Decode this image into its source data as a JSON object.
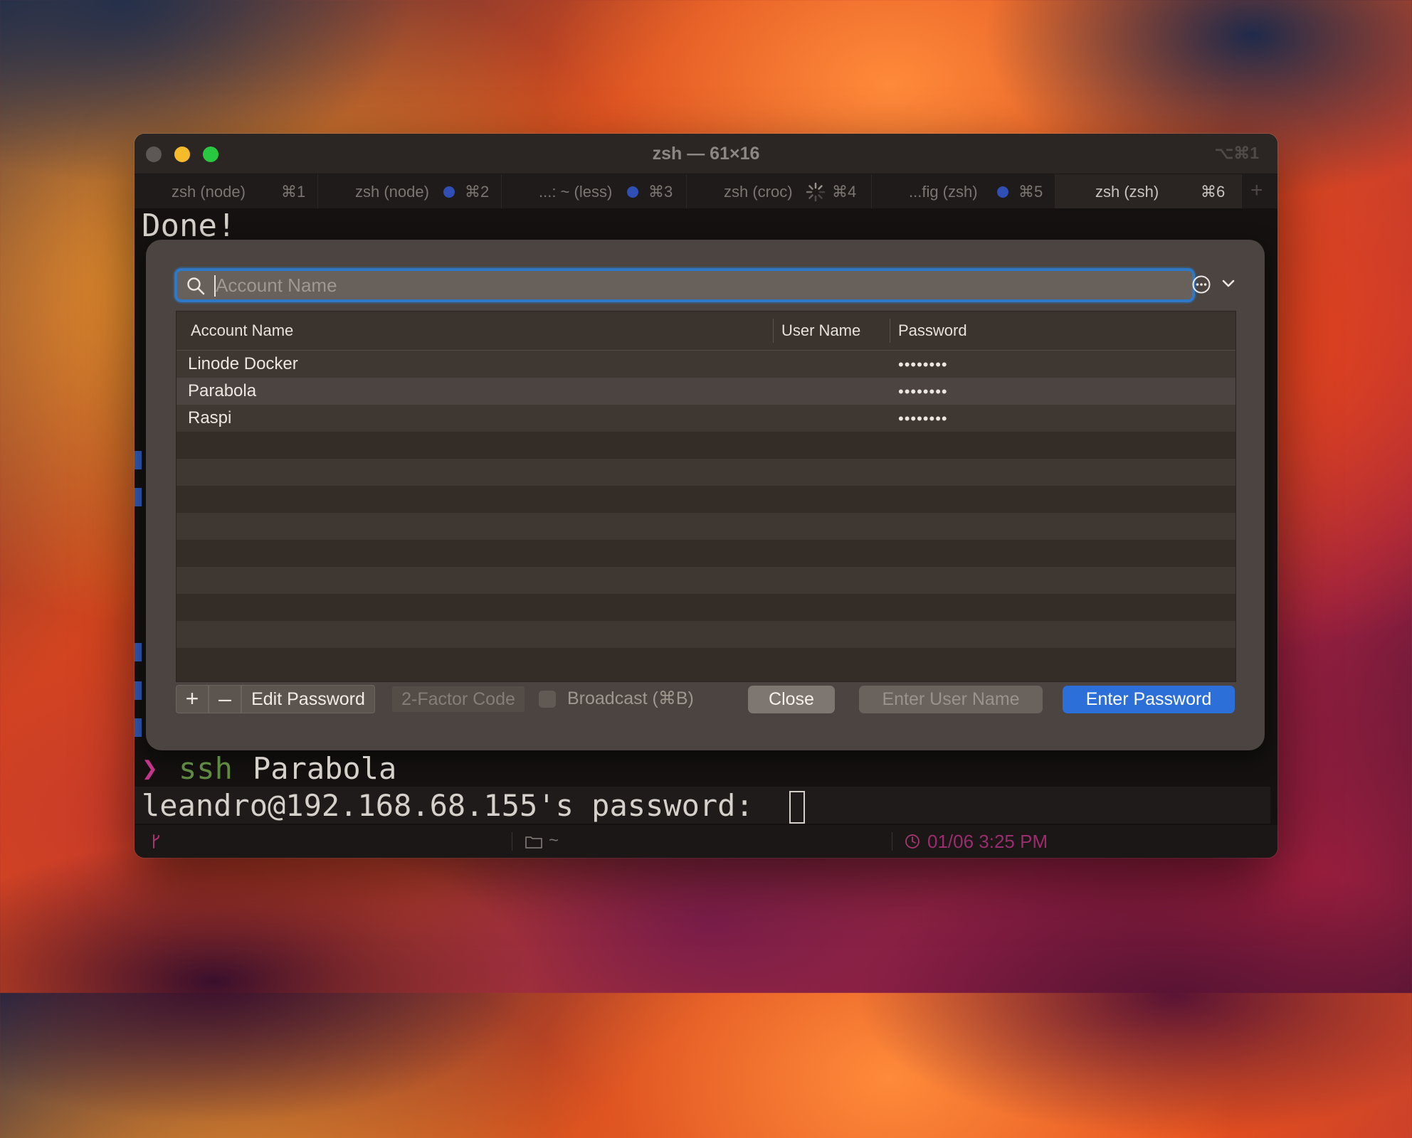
{
  "window": {
    "title": "zsh — 61×16",
    "shortcut": "⌥⌘1",
    "tabs": [
      {
        "label": "zsh (node)",
        "key": "⌘1",
        "dot": false,
        "spinner": false,
        "active": false
      },
      {
        "label": "zsh (node)",
        "key": "⌘2",
        "dot": true,
        "spinner": false,
        "active": false
      },
      {
        "label": "...: ~ (less)",
        "key": "⌘3",
        "dot": true,
        "spinner": false,
        "active": false
      },
      {
        "label": "zsh (croc)",
        "key": "⌘4",
        "dot": false,
        "spinner": true,
        "active": false
      },
      {
        "label": "...fig (zsh)",
        "key": "⌘5",
        "dot": true,
        "spinner": false,
        "active": false
      },
      {
        "label": "zsh (zsh)",
        "key": "⌘6",
        "dot": false,
        "spinner": false,
        "active": true
      }
    ],
    "add_tab": "+"
  },
  "terminal": {
    "done_text": "Done!",
    "command": "ssh",
    "command_arg": "Parabola",
    "password_prompt": "leandro@192.168.68.155's password: "
  },
  "password_manager": {
    "search": {
      "placeholder": "Account Name",
      "value": ""
    },
    "columns": {
      "account": "Account Name",
      "user": "User Name",
      "password": "Password"
    },
    "rows": [
      {
        "account": "Linode Docker",
        "user": "",
        "password": "••••••••"
      },
      {
        "account": "Parabola",
        "user": "",
        "password": "••••••••"
      },
      {
        "account": "Raspi",
        "user": "",
        "password": "••••••••"
      }
    ],
    "selected_row": 1,
    "buttons": {
      "add": "+",
      "remove": "–",
      "edit_password": "Edit Password",
      "two_factor": "2-Factor Code",
      "broadcast": "Broadcast (⌘B)",
      "close": "Close",
      "enter_user": "Enter User Name",
      "enter_password": "Enter Password"
    }
  },
  "status": {
    "cwd": "~",
    "datetime": "01/06 3:25 PM"
  },
  "colors": {
    "accent": "#2c6fd8",
    "prompt_arrow": "#c5338a",
    "command": "#5f8a3f"
  }
}
